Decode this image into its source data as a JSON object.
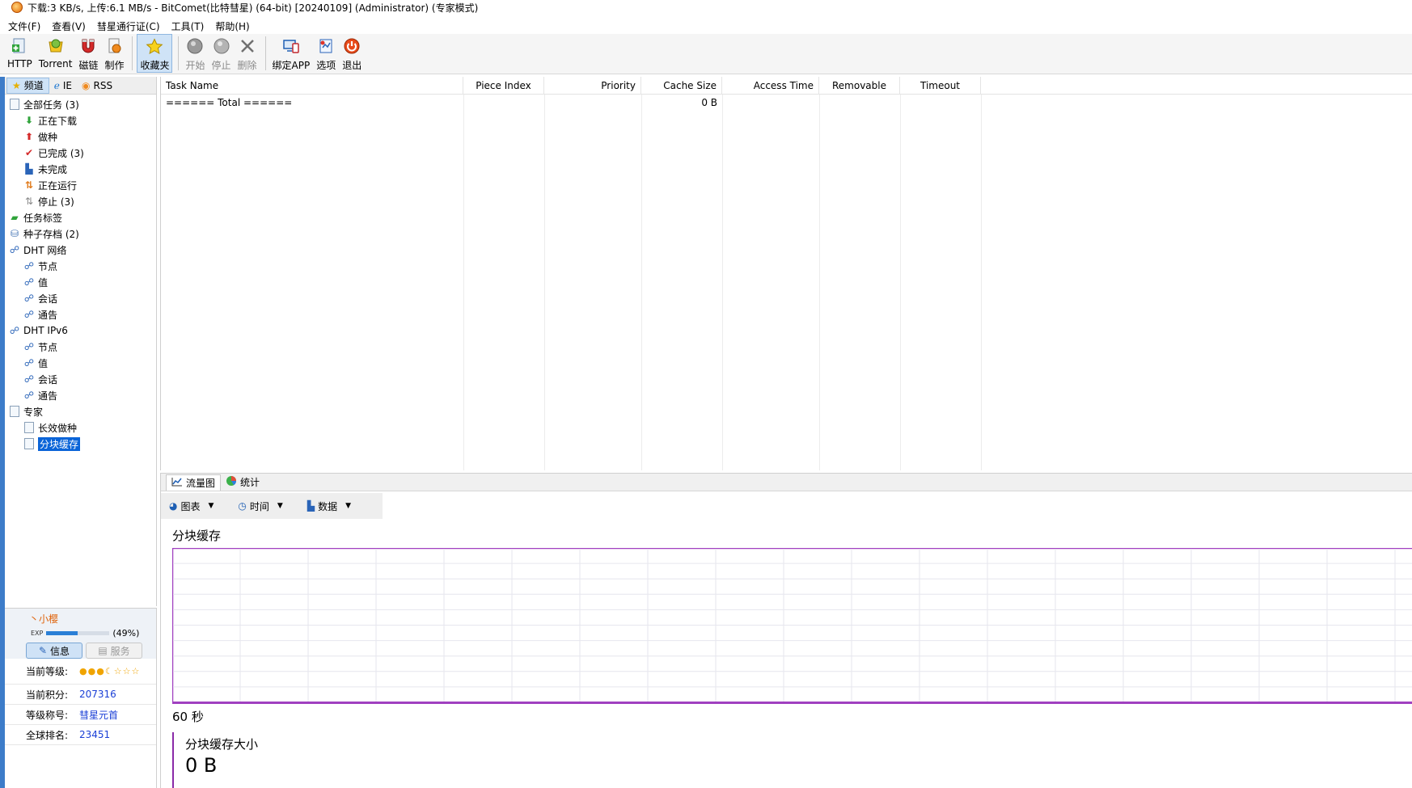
{
  "window": {
    "title": "下载:3 KB/s, 上传:6.1 MB/s - BitComet(比特彗星) (64-bit) [20240109] (Administrator) (专家模式)"
  },
  "menu": [
    "文件(F)",
    "查看(V)",
    "彗星通行证(C)",
    "工具(T)",
    "帮助(H)"
  ],
  "toolbar": {
    "http": "HTTP",
    "torrent": "Torrent",
    "magnet": "磁链",
    "make": "制作",
    "favorites": "收藏夹",
    "start": "开始",
    "stop": "停止",
    "delete": "删除",
    "bind_app": "绑定APP",
    "options": "选项",
    "exit": "退出"
  },
  "left_tabs": [
    "频道",
    "IE",
    "RSS"
  ],
  "tree": [
    {
      "level": 0,
      "label": "全部任务 (3)",
      "icon": "doc-icon"
    },
    {
      "level": 1,
      "label": "正在下载",
      "icon": "download-arrow-icon"
    },
    {
      "level": 1,
      "label": "做种",
      "icon": "upload-arrow-icon"
    },
    {
      "level": 1,
      "label": "已完成 (3)",
      "icon": "check-icon"
    },
    {
      "level": 1,
      "label": "未完成",
      "icon": "incomplete-icon"
    },
    {
      "level": 1,
      "label": "正在运行",
      "icon": "running-icon"
    },
    {
      "level": 1,
      "label": "停止 (3)",
      "icon": "stopped-icon"
    },
    {
      "level": 0,
      "label": "任务标签",
      "icon": "tag-icon"
    },
    {
      "level": 0,
      "label": "种子存档 (2)",
      "icon": "archive-icon"
    },
    {
      "level": 0,
      "label": "DHT 网络",
      "icon": "network-icon"
    },
    {
      "level": 1,
      "label": "节点",
      "icon": "network-icon"
    },
    {
      "level": 1,
      "label": "值",
      "icon": "network-icon"
    },
    {
      "level": 1,
      "label": "会话",
      "icon": "network-icon"
    },
    {
      "level": 1,
      "label": "通告",
      "icon": "network-icon"
    },
    {
      "level": 0,
      "label": "DHT IPv6",
      "icon": "network-icon"
    },
    {
      "level": 1,
      "label": "节点",
      "icon": "network-icon"
    },
    {
      "level": 1,
      "label": "值",
      "icon": "network-icon"
    },
    {
      "level": 1,
      "label": "会话",
      "icon": "network-icon"
    },
    {
      "level": 1,
      "label": "通告",
      "icon": "network-icon"
    },
    {
      "level": 0,
      "label": "专家",
      "icon": "doc-icon"
    },
    {
      "level": 1,
      "label": "长效做种",
      "icon": "doc-icon"
    },
    {
      "level": 1,
      "label": "分块缓存",
      "icon": "doc-icon",
      "selected": true
    }
  ],
  "user": {
    "name": "丶小樱",
    "exp_label": "EXP",
    "exp_percent": 49,
    "exp_text": "(49%)",
    "btn_info": "信息",
    "btn_service": "服务",
    "rows": [
      {
        "key": "当前等级:",
        "value": ""
      },
      {
        "key": "当前积分:",
        "value": "207316"
      },
      {
        "key": "等级称号:",
        "value": "彗星元首"
      },
      {
        "key": "全球排名:",
        "value": "23451"
      }
    ]
  },
  "table": {
    "headers": [
      "Task Name",
      "Piece Index",
      "Priority",
      "Cache Size",
      "Access Time",
      "Removable",
      "Timeout"
    ],
    "rows": [
      [
        "====== Total ======",
        "",
        "",
        "0 B",
        "",
        "",
        ""
      ]
    ]
  },
  "bottom": {
    "tabs": [
      "流量图",
      "统计"
    ],
    "dropdowns": [
      "图表",
      "时间",
      "数据"
    ],
    "chart_title": "分块缓存",
    "chart_xlabel": "60 秒",
    "size_title": "分块缓存大小",
    "size_value": "0 B"
  },
  "colors": {
    "chart_border": "#a040c0",
    "grid": "#e6e6ee",
    "selection": "#0a64d8",
    "link_value": "#1a3fd6"
  }
}
